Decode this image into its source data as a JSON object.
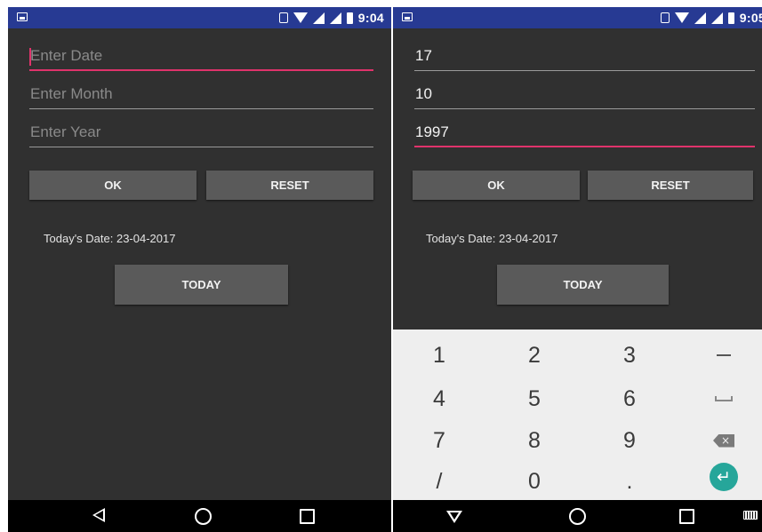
{
  "left": {
    "status": {
      "time": "9:04"
    },
    "fields": {
      "date_placeholder": "Enter Date",
      "month_placeholder": "Enter Month",
      "year_placeholder": "Enter Year"
    },
    "buttons": {
      "ok": "OK",
      "reset": "RESET",
      "today": "TODAY"
    },
    "today_label": "Today's Date: 23-04-2017"
  },
  "right": {
    "status": {
      "time": "9:05"
    },
    "fields": {
      "date_value": "17",
      "month_value": "10",
      "year_value": "1997"
    },
    "buttons": {
      "ok": "OK",
      "reset": "RESET",
      "today": "TODAY"
    },
    "today_label": "Today's Date: 23-04-2017",
    "keyboard": {
      "rows": [
        [
          "1",
          "2",
          "3",
          "−"
        ],
        [
          "4",
          "5",
          "6",
          "space"
        ],
        [
          "7",
          "8",
          "9",
          "backspace"
        ],
        [
          "/",
          "0",
          ".",
          "enter"
        ]
      ]
    }
  },
  "colors": {
    "status_bar": "#273a93",
    "background": "#303030",
    "accent": "#e0336b",
    "button": "#5a5a5a",
    "enter_key": "#26a69a"
  }
}
